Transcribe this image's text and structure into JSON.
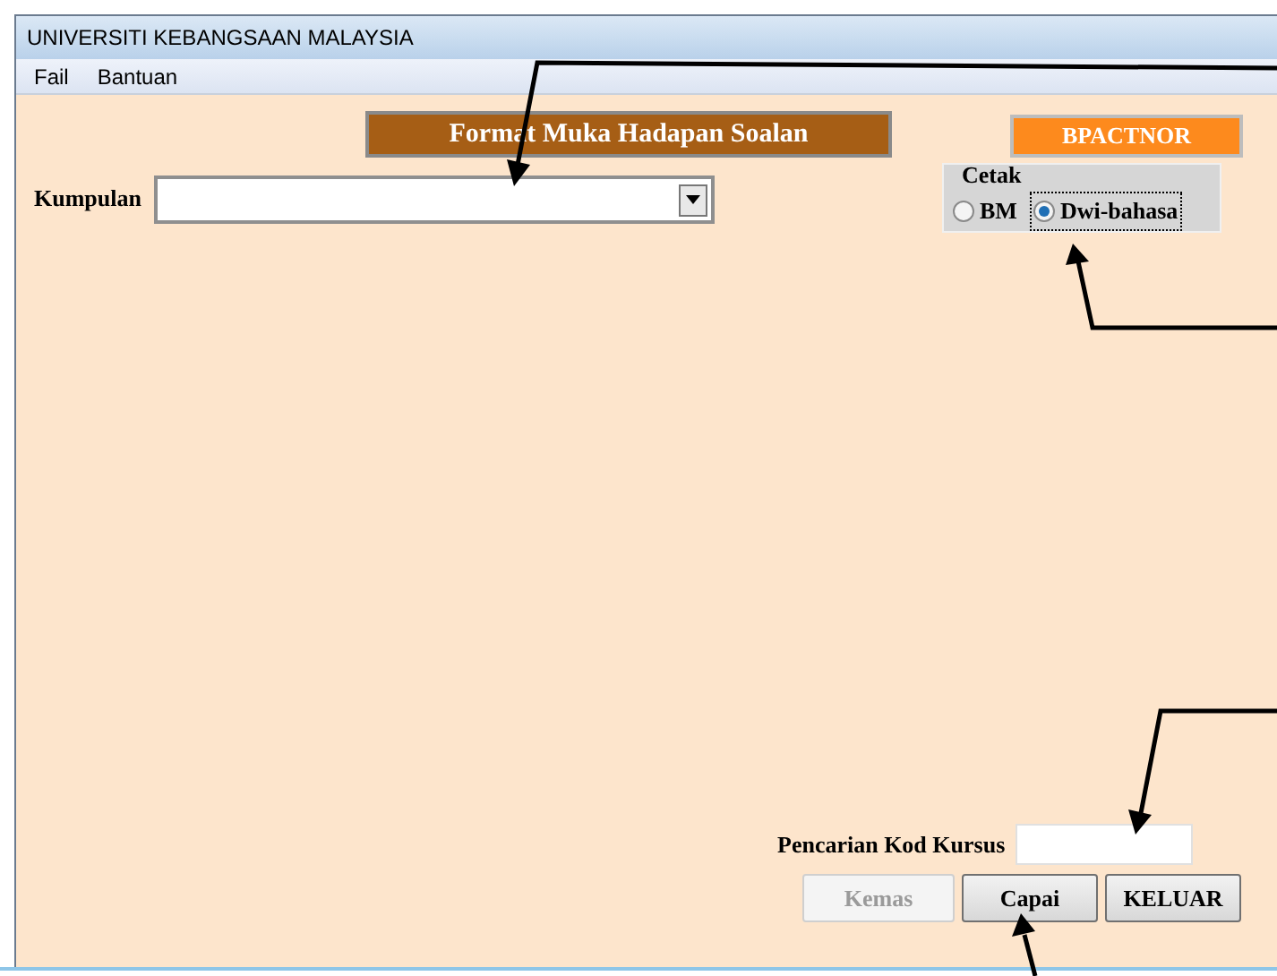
{
  "window": {
    "title": "UNIVERSITI KEBANGSAAN MALAYSIA"
  },
  "menu": [
    "Fail",
    "Bantuan"
  ],
  "header": {
    "title": "Format Muka Hadapan Soalan",
    "code_button": "BPACTNOR"
  },
  "kumpulan": {
    "label": "Kumpulan"
  },
  "cetak": {
    "label": "Cetak",
    "options": [
      {
        "label": "BM",
        "selected": false
      },
      {
        "label": "Dwi-bahasa",
        "selected": true
      }
    ]
  },
  "search": {
    "label": "Pencarian Kod Kursus"
  },
  "buttons": [
    {
      "label": "Kemas",
      "disabled": true
    },
    {
      "label": "Capai",
      "disabled": false
    },
    {
      "label": "KELUAR",
      "disabled": false
    }
  ]
}
